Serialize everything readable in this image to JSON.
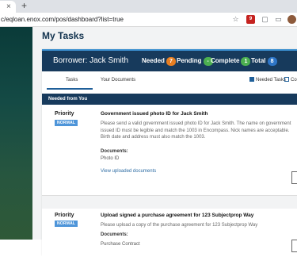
{
  "browser": {
    "url": "c/eqloan.enox.com/pos/dashboard?list=true",
    "new_tab": "+",
    "tab_close": "×",
    "ext_badge": "9"
  },
  "page": {
    "title": "My Tasks"
  },
  "borrower_bar": {
    "name": "Borrower: Jack Smith",
    "stats": [
      {
        "label": "Needed",
        "count": "7",
        "color": "#e67e22"
      },
      {
        "label": "Pending",
        "count": "-",
        "color": "#4caf50"
      },
      {
        "label": "Complete",
        "count": "1",
        "color": "#4caf50"
      },
      {
        "label": "Total",
        "count": "8",
        "color": "#2e75c6"
      }
    ]
  },
  "tabs": [
    {
      "label": "Tasks",
      "active": true
    },
    {
      "label": "Your Documents",
      "active": false
    }
  ],
  "filters": [
    {
      "label": "Needed Tasks",
      "checked": true
    },
    {
      "label": "Co",
      "checked": false
    }
  ],
  "section_header": "Needed from You",
  "tasks": [
    {
      "priority_label": "Priority",
      "priority": "NORMAL",
      "title": "Government issued photo ID for Jack Smith",
      "description": "Please send a valid government issued photo ID for Jack Smith. The name on government issued ID must be legible and match the 1003 in Encompass. Nick names are acceptable. Birth date and address must also match the 1003.",
      "documents_label": "Documents:",
      "documents": [
        "Photo ID"
      ],
      "link": "View uploaded documents"
    },
    {
      "priority_label": "Priority",
      "priority": "NORMAL",
      "title": "Upload signed a purchase agreement for 123 Subjectprop Way",
      "description": "Please upload a copy of the purchase agreement for 123 Subjectprop Way",
      "documents_label": "Documents:",
      "documents": [
        "Purchase Contract"
      ]
    }
  ],
  "colors": {
    "header_navy": "#173a5c",
    "accent_blue": "#3b8fd0",
    "priority_badge": "#4e95d9",
    "link": "#2e6da4"
  }
}
